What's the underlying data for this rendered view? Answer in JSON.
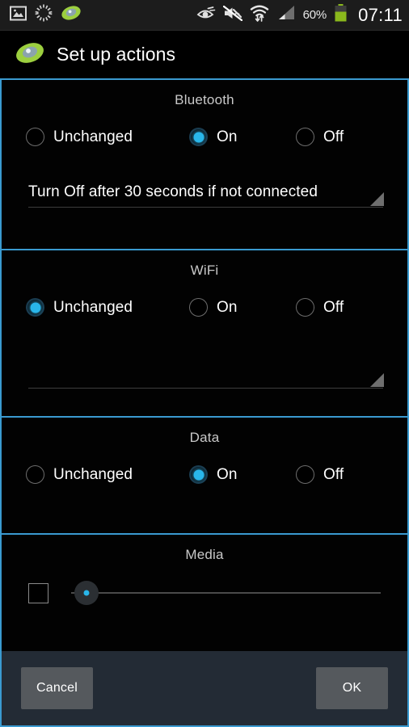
{
  "statusbar": {
    "left_icons": [
      "image-icon",
      "loading-spinner-icon",
      "app-green-disc-icon"
    ],
    "right_icons": [
      "smart-stay-eye-icon",
      "sound-mute-icon",
      "wifi-transfer-icon",
      "cellular-signal-icon"
    ],
    "battery_percent": "60%",
    "battery_icon": "battery-icon",
    "battery_color": "#7cb518",
    "clock": "07:11"
  },
  "titlebar": {
    "icon": "app-green-disc-icon",
    "title": "Set up actions"
  },
  "theme": {
    "accent": "#29b6ea",
    "section_border": "#3a9ad0",
    "background": "#000000",
    "button_bar_bg": "#232b35",
    "button_bg": "#55595d"
  },
  "sections": [
    {
      "title": "Bluetooth",
      "options": [
        {
          "label": "Unchanged",
          "selected": false
        },
        {
          "label": "On",
          "selected": true
        },
        {
          "label": "Off",
          "selected": false
        }
      ],
      "textfield": {
        "value": "Turn Off after 30 seconds if not connected",
        "placeholder": ""
      }
    },
    {
      "title": "WiFi",
      "options": [
        {
          "label": "Unchanged",
          "selected": true
        },
        {
          "label": "On",
          "selected": false
        },
        {
          "label": "Off",
          "selected": false
        }
      ],
      "textfield": {
        "value": "",
        "placeholder": ""
      }
    },
    {
      "title": "Data",
      "options": [
        {
          "label": "Unchanged",
          "selected": false
        },
        {
          "label": "On",
          "selected": true
        },
        {
          "label": "Off",
          "selected": false
        }
      ]
    },
    {
      "title": "Media",
      "checkbox_checked": false,
      "slider_value": 3,
      "slider_min": 0,
      "slider_max": 100
    }
  ],
  "buttons": {
    "cancel": "Cancel",
    "ok": "OK"
  }
}
